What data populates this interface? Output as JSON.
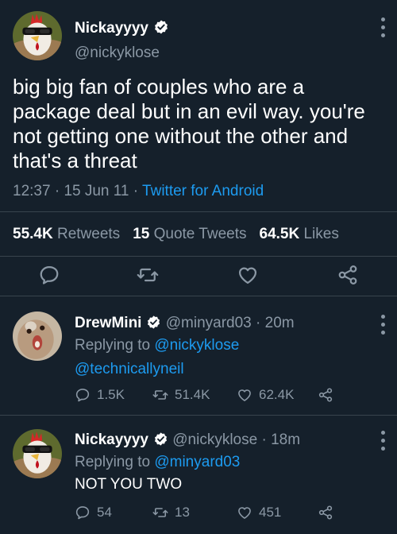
{
  "main_tweet": {
    "display_name": "Nickayyyy",
    "handle": "@nickyklose",
    "text": "big big fan of couples who are a package deal but in an evil way. you're not getting one without the other and that's a threat",
    "time": "12:37",
    "date": "15 Jun 11",
    "source": "Twitter for Android",
    "stats": {
      "retweets_count": "55.4K",
      "retweets_label": "Retweets",
      "quotes_count": "15",
      "quotes_label": "Quote Tweets",
      "likes_count": "64.5K",
      "likes_label": "Likes"
    }
  },
  "replies": [
    {
      "display_name": "DrewMini",
      "handle": "@minyard03",
      "age": "20m",
      "replying_to_label": "Replying to",
      "replying_to": "@nickyklose",
      "replying_to_2": "@technicallyneil",
      "replies_count": "1.5K",
      "retweets_count": "51.4K",
      "likes_count": "62.4K"
    },
    {
      "display_name": "Nickayyyy",
      "handle": "@nickyklose",
      "age": "18m",
      "replying_to_label": "Replying to",
      "replying_to": "@minyard03",
      "text": "NOT YOU TWO",
      "replies_count": "54",
      "retweets_count": "13",
      "likes_count": "451"
    }
  ],
  "separator": "·",
  "colors": {
    "background": "#15202b",
    "text": "#ffffff",
    "muted": "#8b98a5",
    "link": "#1d9bf0",
    "divider": "#38444d"
  },
  "icons": [
    "verified-badge-icon",
    "more-icon",
    "reply-icon",
    "retweet-icon",
    "like-icon",
    "share-icon"
  ]
}
